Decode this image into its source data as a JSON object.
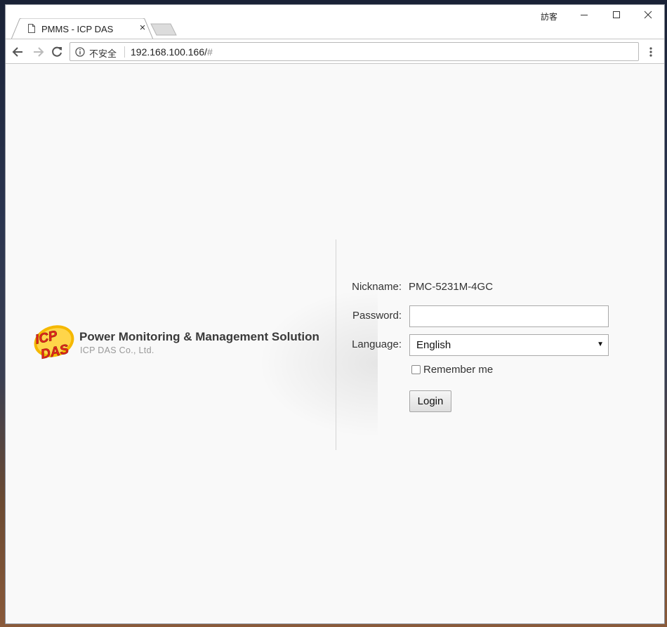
{
  "browser": {
    "tab_title": "PMMS - ICP DAS",
    "tab_close": "×",
    "user_name": "訪客",
    "security_label": "不安全",
    "url_host": "192.168.100.166/",
    "url_path": "#"
  },
  "brand": {
    "logo_top": "ICP",
    "logo_bottom": "DAS",
    "title": "Power Monitoring & Management Solution",
    "subtitle": "ICP DAS Co., Ltd."
  },
  "form": {
    "nickname_label": "Nickname:",
    "nickname_value": "PMC-5231M-4GC",
    "password_label": "Password:",
    "password_value": "",
    "language_label": "Language:",
    "language_value": "English",
    "select_arrow": "▼",
    "remember_label": "Remember me",
    "remember_checked": false,
    "login_label": "Login"
  },
  "colors": {
    "logo_red": "#e8251c",
    "logo_yellow": "#f5b800",
    "page_bg": "#f9f9f9"
  }
}
